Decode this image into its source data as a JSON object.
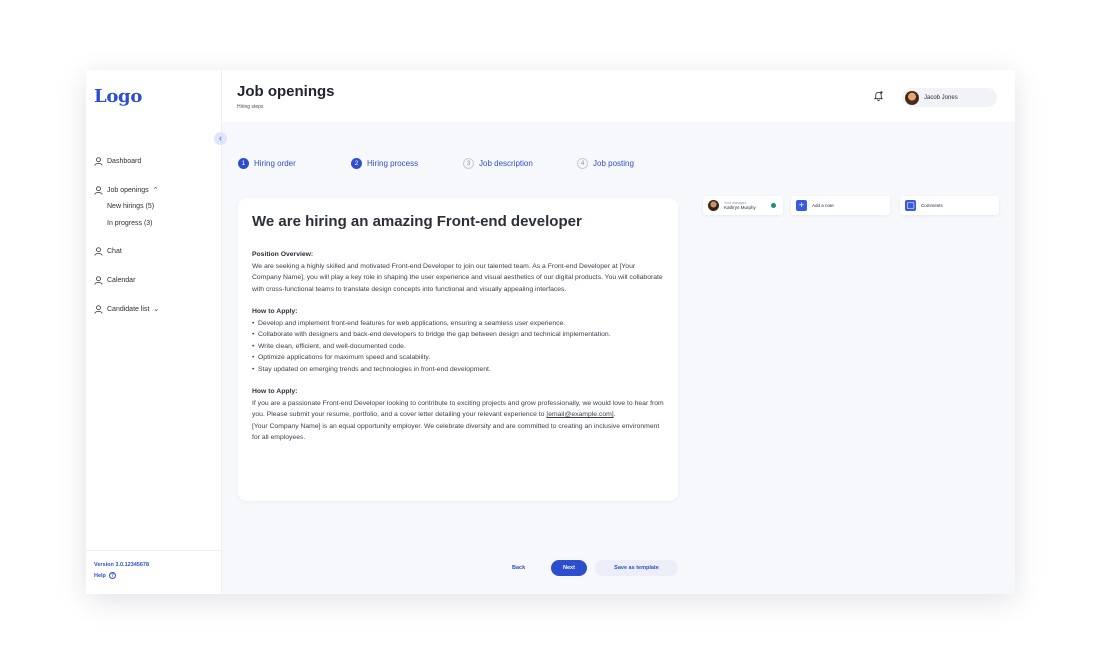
{
  "app": {
    "logo": "Logo",
    "version": "Version 3.0.12345678",
    "help_label": "Help",
    "accent_color": "#2d4fcf"
  },
  "sidebar": {
    "collapse_icon": "chevron-left-icon",
    "items": [
      {
        "label": "Dashboard",
        "icon": "user-icon"
      },
      {
        "label": "Job openings",
        "icon": "user-icon",
        "expanded": true,
        "children": [
          "New hirings (5)",
          "In progress (3)"
        ]
      },
      {
        "label": "Chat",
        "icon": "user-icon"
      },
      {
        "label": "Calendar",
        "icon": "user-icon"
      },
      {
        "label": "Candidate list",
        "icon": "user-icon",
        "expanded": false
      }
    ]
  },
  "header": {
    "title": "Job openings",
    "subtitle": "Hiring steps",
    "bell_icon": "bell-icon",
    "user": {
      "name": "Jacob Jones"
    }
  },
  "steps": [
    {
      "number": "1",
      "label": "Hiring order",
      "state": "done"
    },
    {
      "number": "2",
      "label": "Hiring process",
      "state": "done"
    },
    {
      "number": "3",
      "label": "Job description",
      "state": "todo"
    },
    {
      "number": "4",
      "label": "Job posting",
      "state": "todo"
    }
  ],
  "job_card": {
    "title": "We are hiring an amazing Front-end developer",
    "overview_heading": "Position Overview:",
    "overview_text": "We are seeking a highly skilled and motivated Front-end Developer to join our talented team. As a Front-end Developer at [Your Company Name], you will play a key role in shaping the user experience and visual aesthetics of our digital products. You will collaborate with cross-functional teams to translate design concepts into functional and visually appealing interfaces.",
    "duties_heading": "How to Apply:",
    "duties": [
      "Develop and implement front-end features for web applications, ensuring a seamless user experience.",
      "Collaborate with designers and back-end developers to bridge the gap between design and technical implementation.",
      "Write clean, efficient, and well-documented code.",
      "Optimize applications for maximum speed and scalability.",
      "Stay updated on emerging trends and technologies in front-end development."
    ],
    "apply_heading": "How to Apply:",
    "apply_text_before": "If you are a passionate Front-end Developer looking to contribute to exciting projects and grow professionally, we would love to hear from you. Please submit your resume, portfolio, and a cover letter detailing your relevant experience to ",
    "apply_email": "[email@example.com]",
    "apply_text_after": ".",
    "closing_text": "[Your Company Name] is an equal opportunity employer. We celebrate diversity and are committed to creating an inclusive environment for all employees."
  },
  "side_panel": {
    "manager_role": "Your manager",
    "manager_name": "Kathryn Murphy",
    "status_color": "#1b8a8a",
    "add_note_label": "Add a note",
    "comments_label": "Comments"
  },
  "actions": {
    "back_label": "Back",
    "next_label": "Next",
    "template_label": "Save as template"
  }
}
